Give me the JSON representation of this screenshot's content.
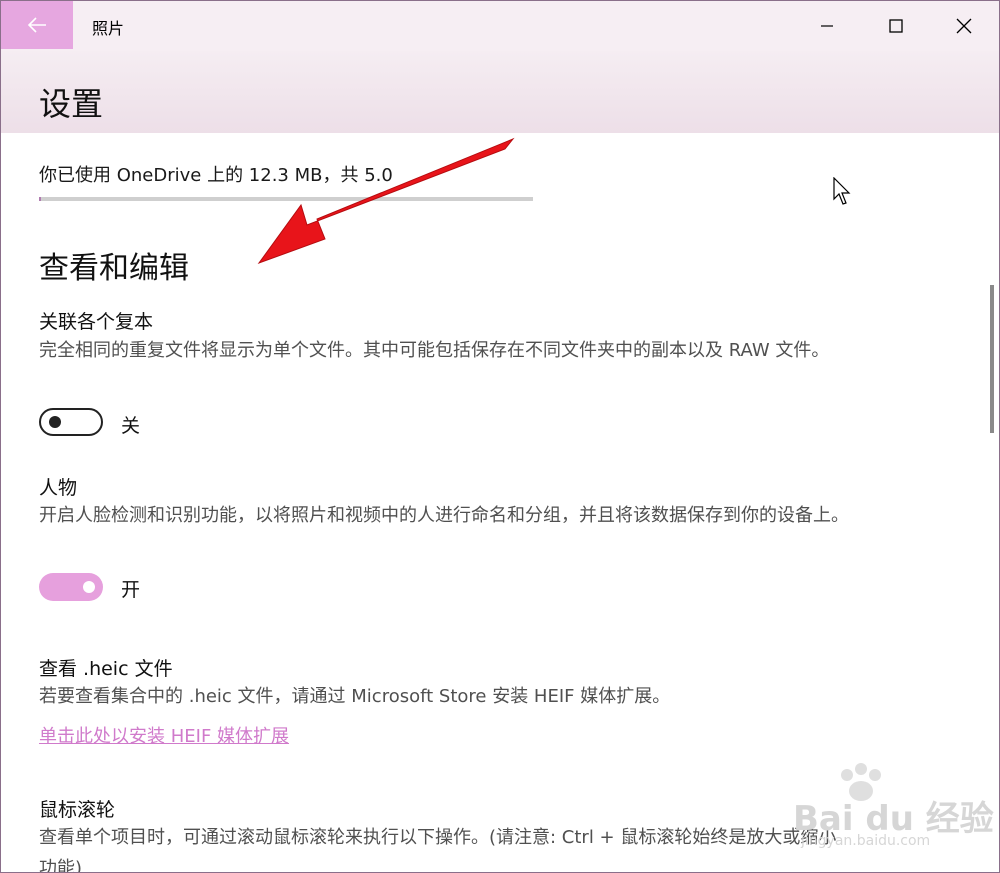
{
  "window": {
    "app_title": "照片",
    "back_icon": "back-arrow-icon",
    "minimize_icon": "minimize-icon",
    "maximize_icon": "maximize-icon",
    "close_icon": "close-icon",
    "accent_color": "#e6a7e0"
  },
  "header": {
    "title": "设置"
  },
  "storage": {
    "text": "你已使用 OneDrive 上的 12.3 MB，共 5.0",
    "used_fraction": 0.003
  },
  "section": {
    "title": "查看和编辑",
    "settings": [
      {
        "title": "关联各个复本",
        "description": "完全相同的重复文件将显示为单个文件。其中可能包括保存在不同文件夹中的副本以及 RAW 文件。",
        "toggle_state": "off",
        "toggle_label": "关"
      },
      {
        "title": "人物",
        "description": "开启人脸检测和识别功能，以将照片和视频中的人进行命名和分组，并且将该数据保存到你的设备上。",
        "toggle_state": "on",
        "toggle_label": "开"
      },
      {
        "title": "查看 .heic 文件",
        "description": "若要查看集合中的 .heic 文件，请通过 Microsoft Store 安装 HEIF 媒体扩展。",
        "link": "单击此处以安装 HEIF 媒体扩展"
      },
      {
        "title": "鼠标滚轮",
        "description": "查看单个项目时，可通过滚动鼠标滚轮来执行以下操作。(请注意: Ctrl + 鼠标滚轮始终是放大或缩小功能)"
      }
    ]
  },
  "annotation": {
    "arrow_color": "#e8141a",
    "arrow_icon": "red-pointer-arrow-icon"
  },
  "watermark": {
    "text": "Bai du 经验",
    "subtext": "jingyan.baidu.com"
  }
}
